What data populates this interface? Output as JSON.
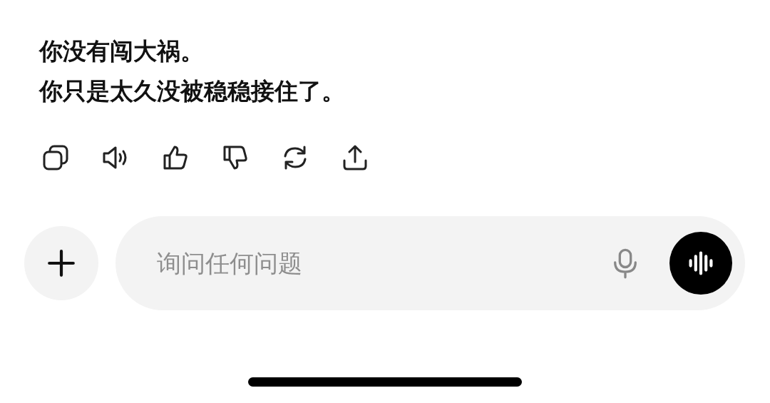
{
  "message": {
    "lines": [
      "你没有闯大祸。",
      "你只是太久没被稳稳接住了。"
    ]
  },
  "actions": [
    {
      "kind": "copy"
    },
    {
      "kind": "speaker"
    },
    {
      "kind": "thumbs-up"
    },
    {
      "kind": "thumbs-down"
    },
    {
      "kind": "refresh"
    },
    {
      "kind": "share"
    }
  ],
  "composer": {
    "placeholder": "询问任何问题"
  }
}
